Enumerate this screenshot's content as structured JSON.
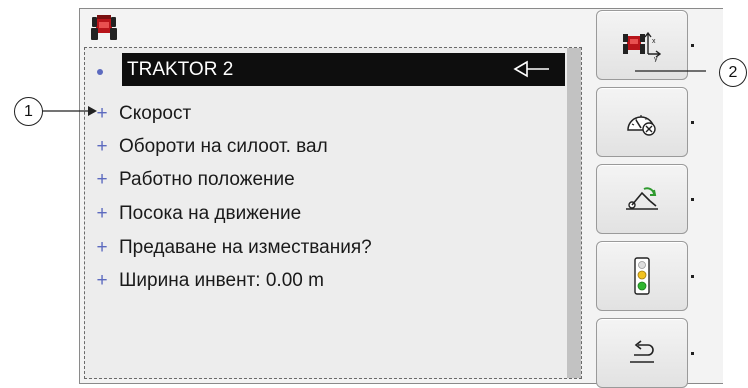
{
  "list": {
    "selected_label": "TRAKTOR 2",
    "bullet_symbol": "+",
    "items": [
      {
        "label": "Скорост"
      },
      {
        "label": "Обороти на силоот. вал"
      },
      {
        "label": "Работно положение"
      },
      {
        "label": "Посока на движение"
      },
      {
        "label": "Предаване на измествания?"
      },
      {
        "label": "Ширина инвент: 0.00 m"
      }
    ]
  },
  "callouts": {
    "left_label": "1",
    "right_label": "2"
  },
  "softkeys": [
    {
      "icon": "tractor-xy-icon"
    },
    {
      "icon": "speedometer-icon"
    },
    {
      "icon": "hitch-lift-icon"
    },
    {
      "icon": "traffic-light-icon"
    },
    {
      "icon": "back-arrow-icon"
    }
  ],
  "colors": {
    "selected_bg": "#0e0e0e",
    "bullet": "#5c6abf",
    "tractor_red": "#b8141a",
    "traffic_green": "#2fb52f",
    "traffic_yellow": "#f2c21e"
  }
}
